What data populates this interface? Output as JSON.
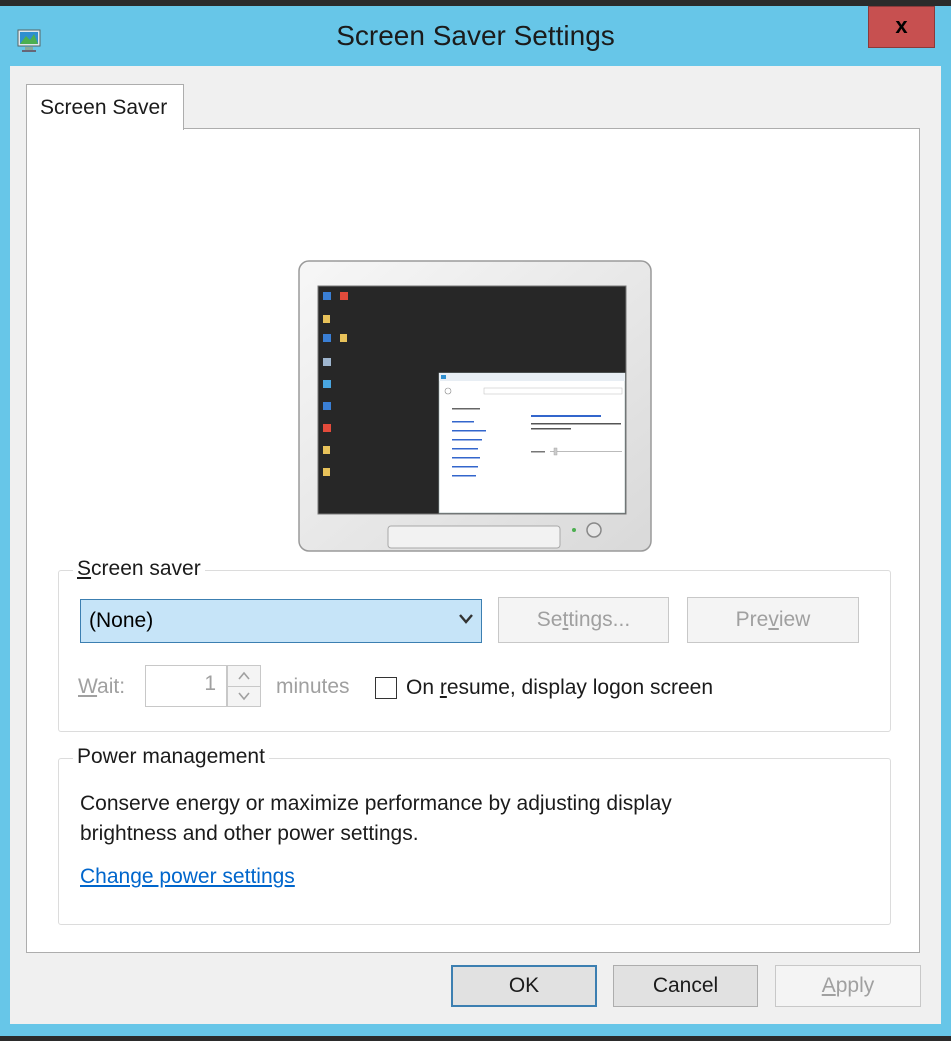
{
  "window": {
    "title": "Screen Saver Settings",
    "close_label": "x"
  },
  "tabs": [
    {
      "label": "Screen Saver"
    }
  ],
  "screen_saver_group": {
    "legend_first": "S",
    "legend_rest": "creen saver",
    "selected_saver": "(None)",
    "settings_btn": {
      "pre": "Se",
      "key": "t",
      "post": "tings..."
    },
    "preview_btn": {
      "pre": "Pre",
      "key": "v",
      "post": "iew"
    },
    "wait_label_key": "W",
    "wait_label_rest": "ait:",
    "wait_value": "1",
    "minutes_label": "minutes",
    "resume_checkbox": {
      "pre": "On ",
      "key": "r",
      "post": "esume, display logon screen",
      "checked": false
    }
  },
  "power_group": {
    "legend": "Power management",
    "description_line1": "Conserve energy or maximize performance by adjusting display",
    "description_line2": "brightness and other power settings.",
    "link": "Change power settings"
  },
  "footer": {
    "ok": "OK",
    "cancel": "Cancel",
    "apply_key": "A",
    "apply_rest": "pply"
  },
  "colors": {
    "title_bar": "#67c6e8",
    "close_button": "#c75050",
    "combo_selected": "#c6e4f8",
    "link": "#0066cc"
  }
}
